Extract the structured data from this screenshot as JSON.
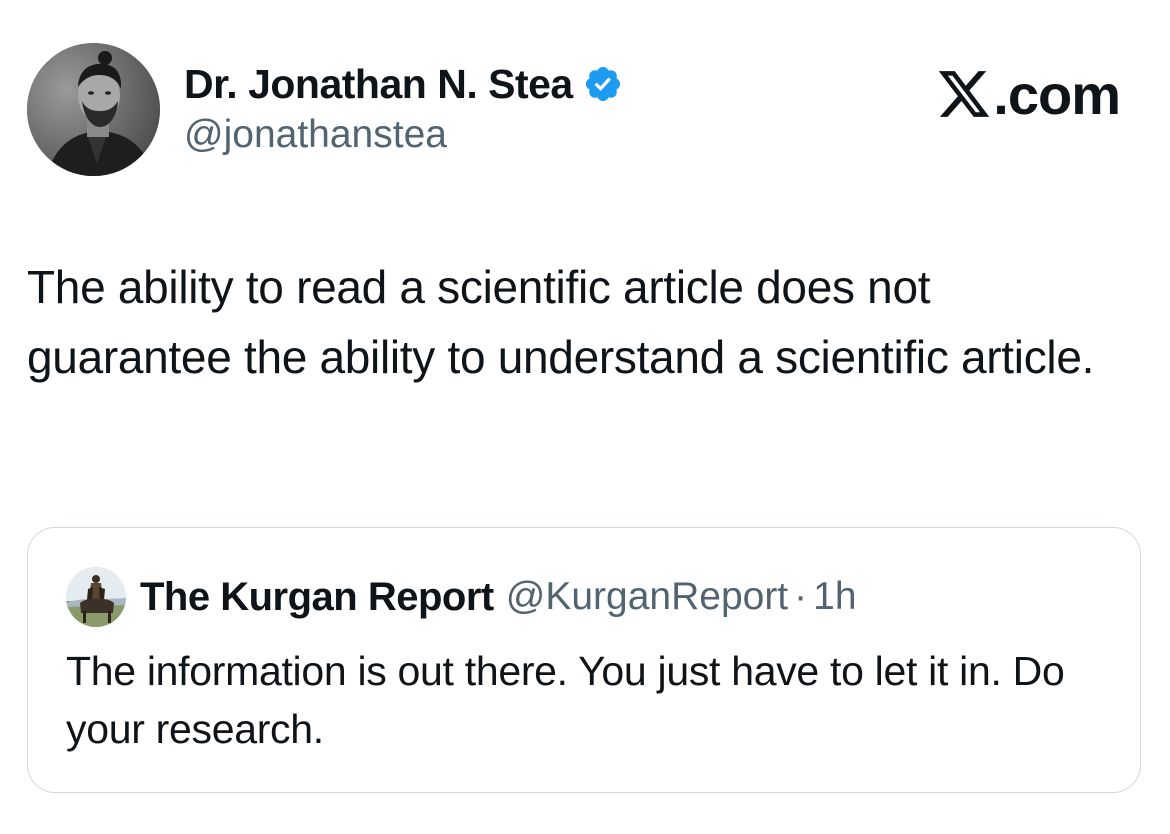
{
  "author": {
    "display_name": "Dr. Jonathan N. Stea",
    "handle": "@jonathanstea",
    "verified": true,
    "verified_icon": "verified-badge-icon",
    "avatar_icon": "author-avatar"
  },
  "brand": {
    "label": ".com",
    "logo_icon": "x-logo-icon"
  },
  "tweet": {
    "text": "The ability to read a scientific article does not guarantee the ability to understand a scientific article."
  },
  "quoted_tweet": {
    "display_name": "The Kurgan Report",
    "handle": "@KurganReport",
    "separator": "·",
    "time": "1h",
    "text": "The information is out there.  You just have to let it in. Do your research.",
    "avatar_icon": "quoted-avatar"
  },
  "colors": {
    "text_primary": "#0f1419",
    "text_secondary": "#536471",
    "verified_blue": "#1d9bf0",
    "card_border": "#cfd9de"
  }
}
